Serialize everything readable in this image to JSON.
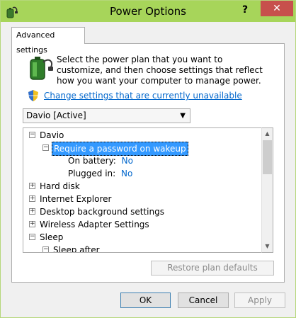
{
  "window": {
    "title": "Power Options",
    "help_label": "?",
    "close_label": "✕"
  },
  "tab": {
    "label": "Advanced settings"
  },
  "intro": {
    "description": "Select the power plan that you want to customize, and then choose settings that reflect how you want your computer to manage power.",
    "change_link": "Change settings that are currently unavailable"
  },
  "plan_select": {
    "value": "Davio [Active]"
  },
  "tree": {
    "items": [
      {
        "label": "Davio",
        "expander": "−"
      },
      {
        "label": "Require a password on wakeup",
        "expander": "−"
      },
      {
        "label": "On battery:",
        "value": "No"
      },
      {
        "label": "Plugged in:",
        "value": "No"
      },
      {
        "label": "Hard disk",
        "expander": "+"
      },
      {
        "label": "Internet Explorer",
        "expander": "+"
      },
      {
        "label": "Desktop background settings",
        "expander": "+"
      },
      {
        "label": "Wireless Adapter Settings",
        "expander": "+"
      },
      {
        "label": "Sleep",
        "expander": "−"
      },
      {
        "label": "Sleep after",
        "expander": "−"
      }
    ]
  },
  "buttons": {
    "restore": "Restore plan defaults",
    "ok": "OK",
    "cancel": "Cancel",
    "apply": "Apply"
  }
}
